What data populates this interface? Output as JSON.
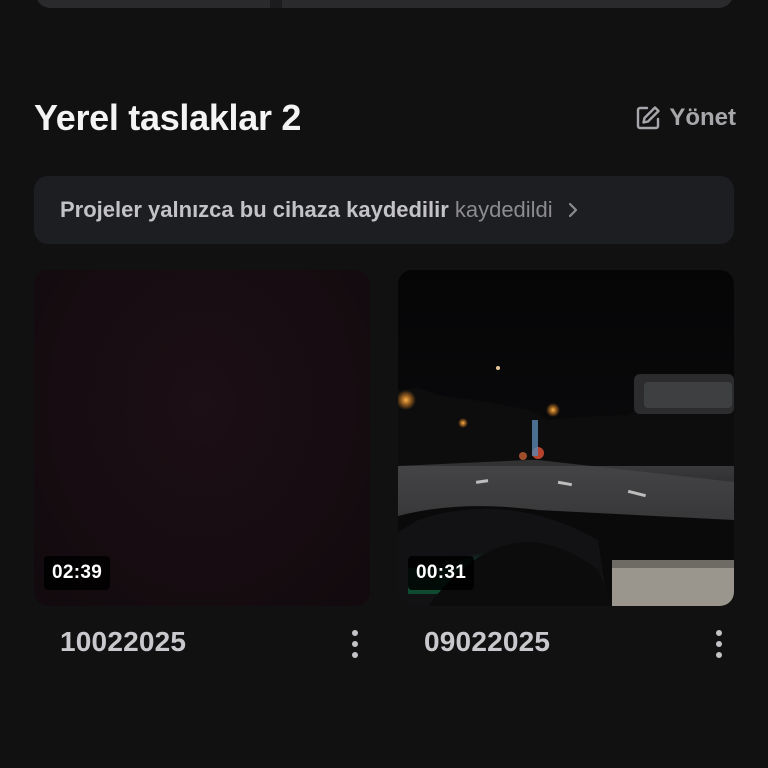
{
  "section": {
    "title": "Yerel taslaklar 2",
    "manage_label": "Yönet",
    "manage_icon": "edit-square-icon"
  },
  "notice": {
    "text": "Projeler yalnızca bu cihaza kaydedilir",
    "status": "kaydedildi",
    "chevron_icon": "chevron-right-icon"
  },
  "drafts": [
    {
      "name": "10022025",
      "duration": "02:39",
      "thumbnail": "dark-maroon-blank-frame",
      "menu_icon": "more-vertical-icon"
    },
    {
      "name": "09022025",
      "duration": "00:31",
      "thumbnail": "night-driving-road-view",
      "menu_icon": "more-vertical-icon"
    }
  ],
  "colors": {
    "background": "#111112",
    "notice_bg": "#1d1e22",
    "title_text": "#f4f4f4",
    "muted_text": "#a7a7ab"
  }
}
